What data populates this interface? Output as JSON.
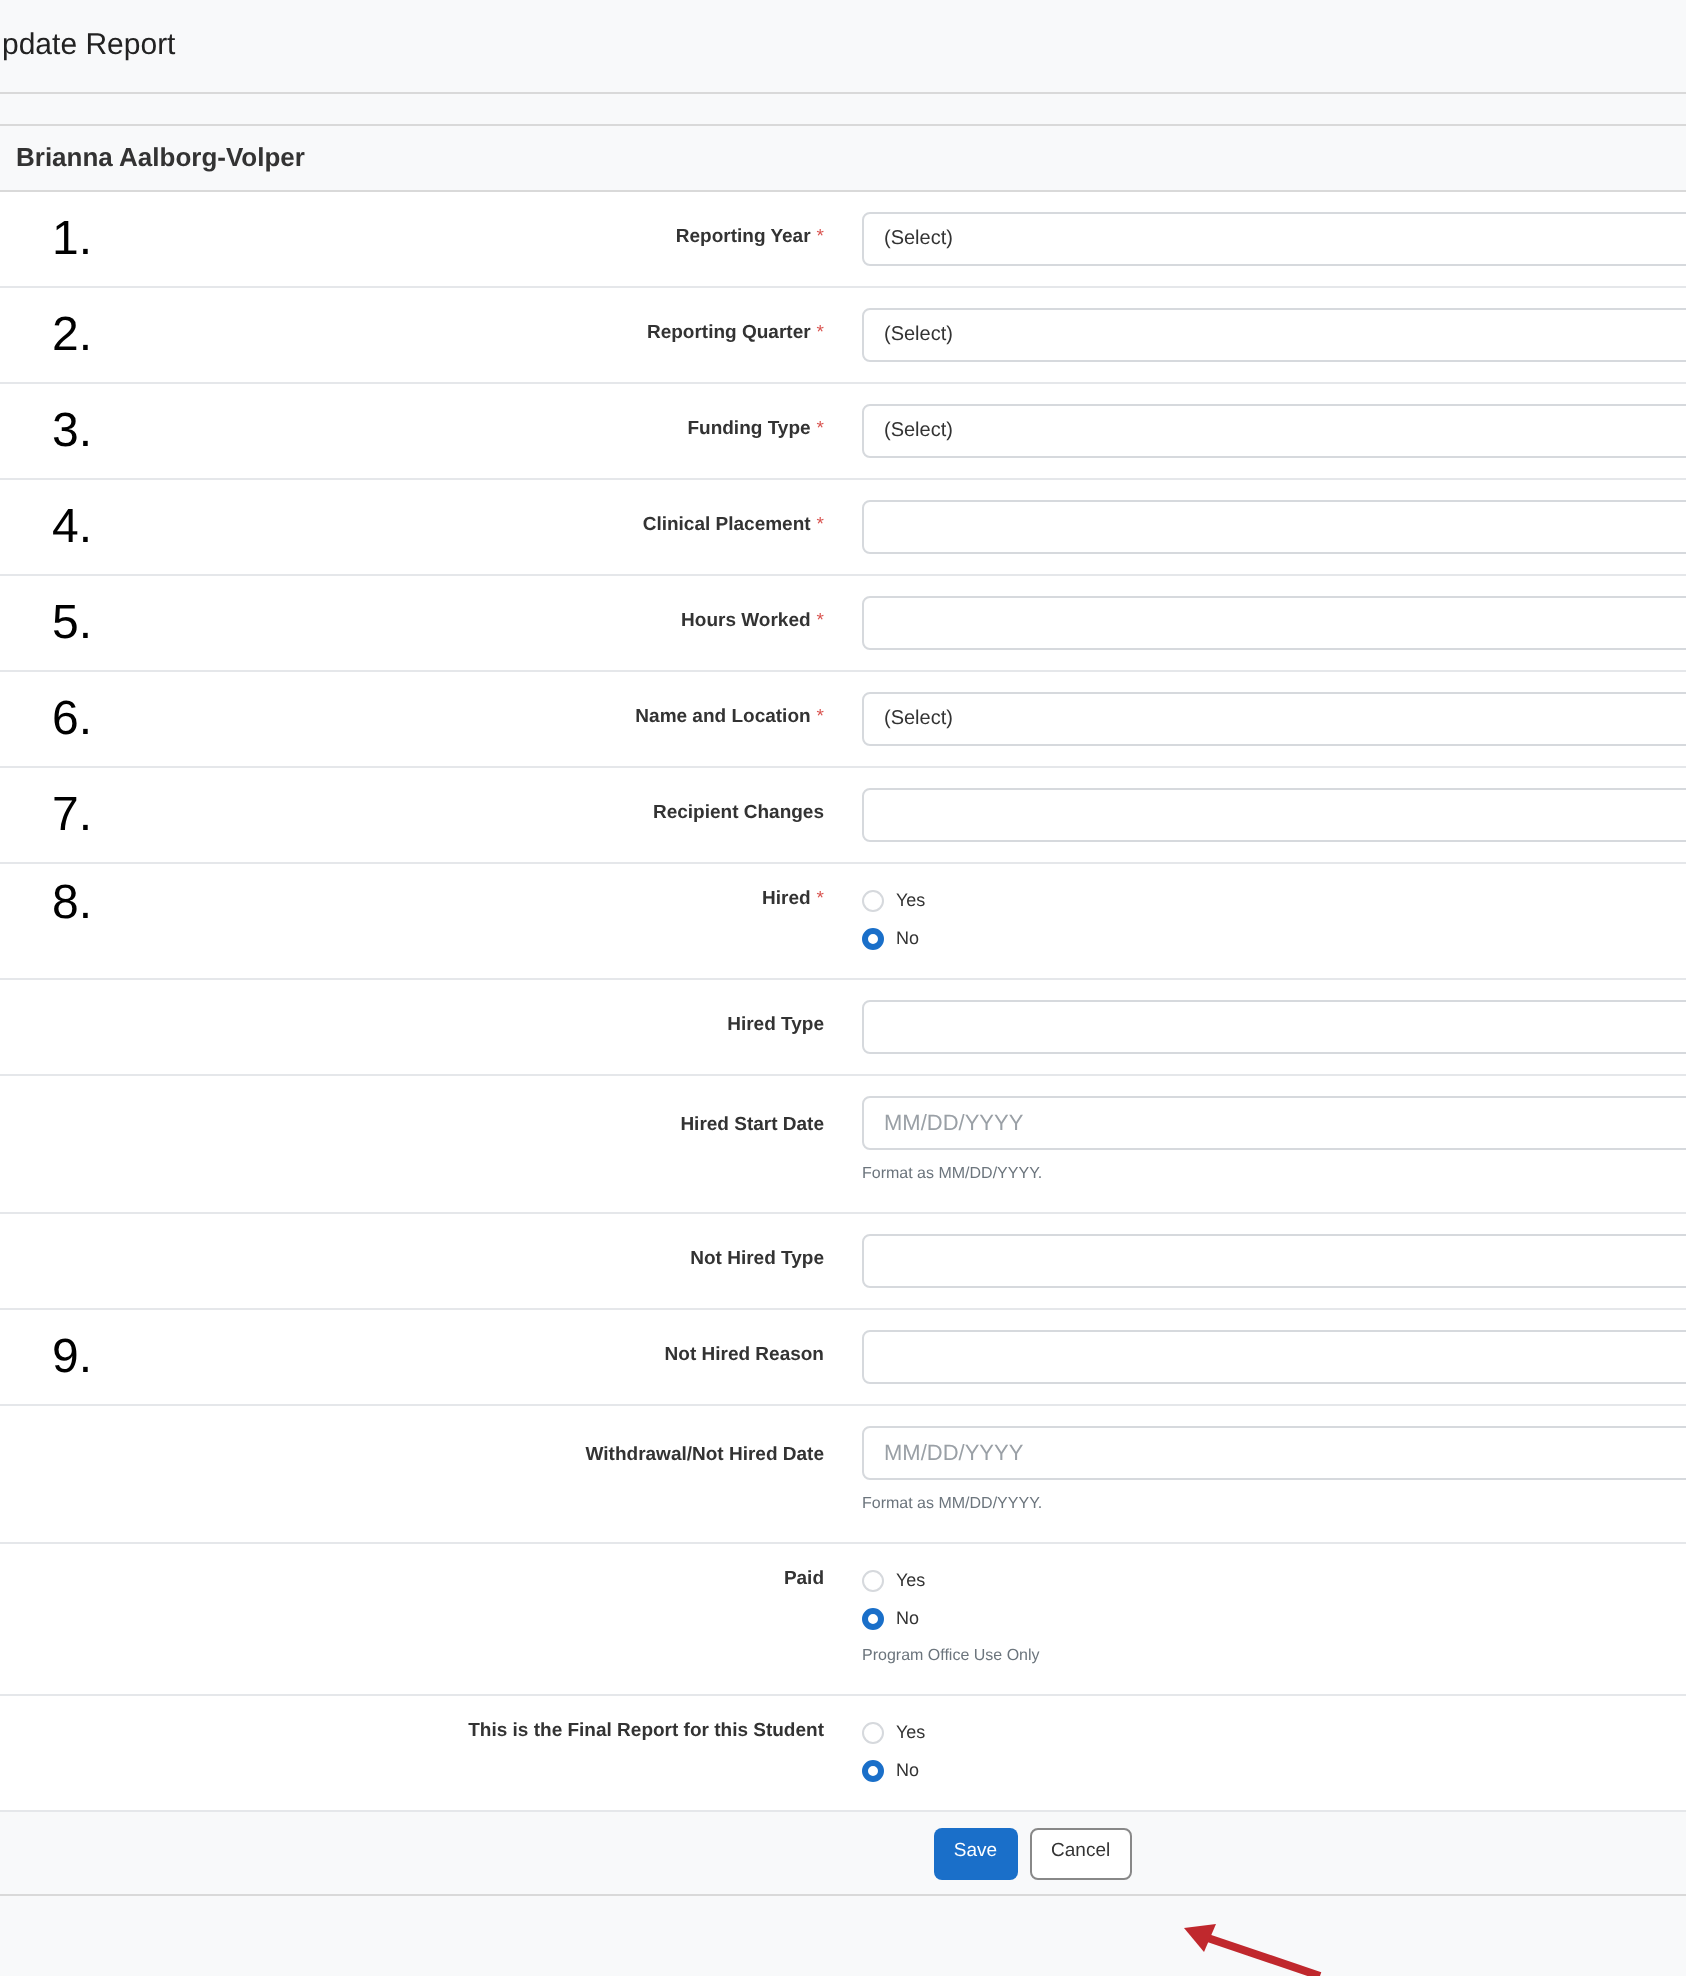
{
  "page_title": "pdate Report",
  "student_name": "Brianna Aalborg-Volper",
  "rows": [
    {
      "marker": "1.",
      "label": "Reporting Year",
      "required_mark": "*",
      "kind": "select",
      "value": "(Select)"
    },
    {
      "marker": "2.",
      "label": "Reporting Quarter",
      "required_mark": "*",
      "kind": "select",
      "value": "(Select)"
    },
    {
      "marker": "3.",
      "label": "Funding Type",
      "required_mark": "*",
      "kind": "select",
      "value": "(Select)"
    },
    {
      "marker": "4.",
      "label": "Clinical Placement",
      "required_mark": "*",
      "kind": "text"
    },
    {
      "marker": "5.",
      "label": "Hours Worked",
      "required_mark": "*",
      "kind": "text"
    },
    {
      "marker": "6.",
      "label": "Name and Location",
      "required_mark": "*",
      "kind": "select",
      "value": "(Select)"
    },
    {
      "marker": "7.",
      "label": "Recipient Changes",
      "kind": "text"
    },
    {
      "marker": "8.",
      "label": "Hired",
      "required_mark": "*",
      "kind": "radio",
      "options": [
        {
          "label": "Yes",
          "selected": false
        },
        {
          "label": "No",
          "selected": true
        }
      ]
    },
    {
      "label": "Hired Type",
      "kind": "text"
    },
    {
      "label": "Hired Start Date",
      "kind": "date",
      "placeholder": "MM/DD/YYYY",
      "help": "Format as MM/DD/YYYY."
    },
    {
      "label": "Not Hired Type",
      "kind": "text"
    },
    {
      "marker": "9.",
      "label": "Not Hired Reason",
      "kind": "text"
    },
    {
      "label": "Withdrawal/Not Hired Date",
      "kind": "date",
      "placeholder": "MM/DD/YYYY",
      "help": "Format as MM/DD/YYYY."
    },
    {
      "label": "Paid",
      "kind": "radio",
      "options": [
        {
          "label": "Yes",
          "selected": false
        },
        {
          "label": "No",
          "selected": true
        }
      ],
      "help": "Program Office Use Only"
    },
    {
      "label": "This is the Final Report for this Student",
      "kind": "radio",
      "options": [
        {
          "label": "Yes",
          "selected": false
        },
        {
          "label": "No",
          "selected": true
        }
      ]
    }
  ],
  "buttons": [
    {
      "label": "Save",
      "kind": "primary"
    },
    {
      "label": "Cancel",
      "kind": "secondary"
    }
  ]
}
